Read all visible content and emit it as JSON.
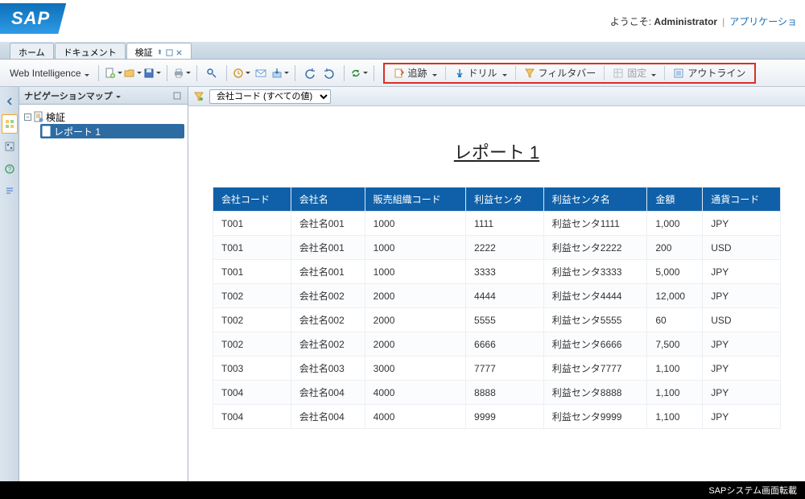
{
  "header": {
    "logo_text": "SAP",
    "welcome_prefix": "ようこそ: ",
    "user": "Administrator",
    "app_link": "アプリケーショ"
  },
  "tabs": {
    "home": "ホーム",
    "documents": "ドキュメント",
    "doc_name": "検証"
  },
  "toolbar": {
    "wi_label": "Web Intelligence"
  },
  "highlight_toolbar": {
    "track": "追跡",
    "drill": "ドリル",
    "filter": "フィルタバー",
    "freeze": "固定",
    "outline": "アウトライン"
  },
  "nav": {
    "title": "ナビゲーションマップ",
    "root": "検証",
    "report": "レポート 1"
  },
  "filter_bar": {
    "select_value": "会社コード (すべての値)"
  },
  "report": {
    "title": "レポート 1",
    "columns": [
      "会社コード",
      "会社名",
      "販売組織コード",
      "利益センタ",
      "利益センタ名",
      "金額",
      "通貨コード"
    ],
    "rows": [
      [
        "T001",
        "会社名001",
        "1000",
        "1111",
        "利益センタ1111",
        "1,000",
        "JPY"
      ],
      [
        "T001",
        "会社名001",
        "1000",
        "2222",
        "利益センタ2222",
        "200",
        "USD"
      ],
      [
        "T001",
        "会社名001",
        "1000",
        "3333",
        "利益センタ3333",
        "5,000",
        "JPY"
      ],
      [
        "T002",
        "会社名002",
        "2000",
        "4444",
        "利益センタ4444",
        "12,000",
        "JPY"
      ],
      [
        "T002",
        "会社名002",
        "2000",
        "5555",
        "利益センタ5555",
        "60",
        "USD"
      ],
      [
        "T002",
        "会社名002",
        "2000",
        "6666",
        "利益センタ6666",
        "7,500",
        "JPY"
      ],
      [
        "T003",
        "会社名003",
        "3000",
        "7777",
        "利益センタ7777",
        "1,100",
        "JPY"
      ],
      [
        "T004",
        "会社名004",
        "4000",
        "8888",
        "利益センタ8888",
        "1,100",
        "JPY"
      ],
      [
        "T004",
        "会社名004",
        "4000",
        "9999",
        "利益センタ9999",
        "1,100",
        "JPY"
      ]
    ]
  },
  "footer": {
    "caption": "SAPシステム画面転載"
  },
  "icons": {
    "page_new": "page-new-icon",
    "open": "folder-open-icon",
    "save": "save-icon",
    "print": "print-icon",
    "find": "find-icon",
    "history": "history-icon",
    "mail": "mail-icon",
    "export": "export-icon",
    "undo": "undo-icon",
    "redo": "redo-icon",
    "refresh": "refresh-icon",
    "track": "track-changes-icon",
    "drill": "drill-icon",
    "filter": "filter-icon",
    "freeze": "freeze-icon",
    "outline": "outline-icon",
    "collapse_left": "collapse-left-icon",
    "nav_map": "nav-map-icon",
    "input_controls": "input-controls-icon",
    "help": "help-icon",
    "structure": "structure-icon",
    "document": "document-icon",
    "prompt": "prompt-icon",
    "pin": "pin-icon",
    "close": "close-icon"
  }
}
